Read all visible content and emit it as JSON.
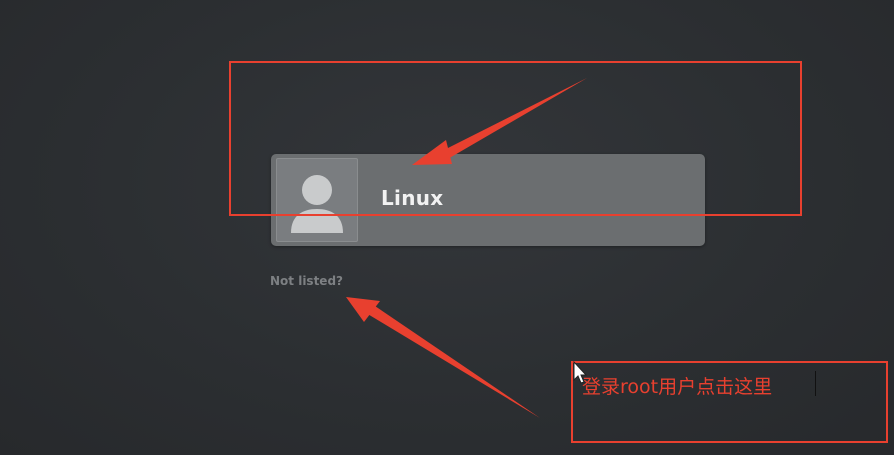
{
  "login": {
    "user_name": "Linux",
    "not_listed_label": "Not listed?"
  },
  "annotation": {
    "note": "登录root用户点击这里",
    "accent_color": "#e8402f"
  },
  "icons": {
    "avatar": "default-user-avatar-icon",
    "cursor": "mouse-pointer-icon"
  }
}
